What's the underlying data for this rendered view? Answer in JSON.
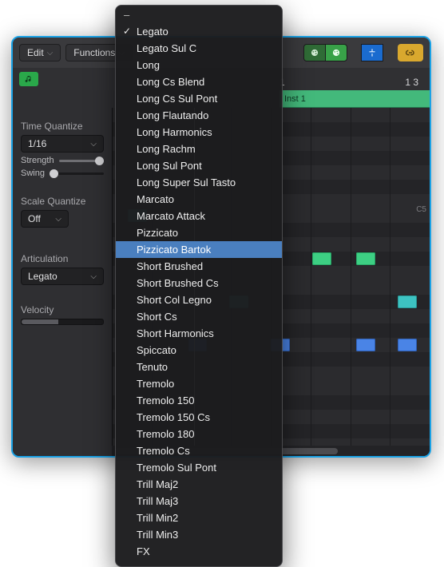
{
  "toolbar": {
    "edit_label": "Edit",
    "functions_label": "Functions"
  },
  "ruler": {
    "bars": [
      "1",
      "1 3"
    ]
  },
  "track": {
    "name": "Inst 1"
  },
  "left_panel": {
    "time_quantize_label": "Time Quantize",
    "time_quantize_value": "1/16",
    "time_strength_label": "Strength",
    "time_strength_value": "100",
    "swing_label": "Swing",
    "scale_quantize_label": "Scale Quantize",
    "scale_quantize_value": "Off",
    "articulation_label": "Articulation",
    "articulation_value": "Legato",
    "velocity_label": "Velocity",
    "velocity_value": "55"
  },
  "pitch_labels": {
    "c5": "C5"
  },
  "articulation_menu": {
    "selected": "Legato",
    "highlighted": "Pizzicato Bartok",
    "items": [
      "Legato",
      "Legato Sul C",
      "Long",
      "Long Cs Blend",
      "Long Cs Sul Pont",
      "Long Flautando",
      "Long Harmonics",
      "Long Rachm",
      "Long Sul Pont",
      "Long Super Sul Tasto",
      "Marcato",
      "Marcato Attack",
      "Pizzicato",
      "Pizzicato Bartok",
      "Short Brushed",
      "Short Brushed Cs",
      "Short Col Legno",
      "Short Cs",
      "Short Harmonics",
      "Spiccato",
      "Tenuto",
      "Tremolo",
      "Tremolo 150",
      "Tremolo 150 Cs",
      "Tremolo 180",
      "Tremolo Cs",
      "Tremolo Sul Pont",
      "Trill Maj2",
      "Trill Maj3",
      "Trill Min2",
      "Trill Min3",
      "FX"
    ]
  },
  "notes": [
    {
      "row": 7,
      "x": 0.05,
      "w": 0.06,
      "cls": "n-teal"
    },
    {
      "row": 10,
      "x": 0.63,
      "w": 0.06,
      "cls": "n-green"
    },
    {
      "row": 10,
      "x": 0.77,
      "w": 0.06,
      "cls": "n-green"
    },
    {
      "row": 13,
      "x": 0.37,
      "w": 0.06,
      "cls": "n-teal"
    },
    {
      "row": 13,
      "x": 0.9,
      "w": 0.06,
      "cls": "n-teal"
    },
    {
      "row": 16,
      "x": 0.24,
      "w": 0.06,
      "cls": "n-blue"
    },
    {
      "row": 16,
      "x": 0.5,
      "w": 0.06,
      "cls": "n-blue"
    },
    {
      "row": 16,
      "x": 0.77,
      "w": 0.06,
      "cls": "n-blue"
    },
    {
      "row": 16,
      "x": 0.9,
      "w": 0.06,
      "cls": "n-blue"
    }
  ]
}
